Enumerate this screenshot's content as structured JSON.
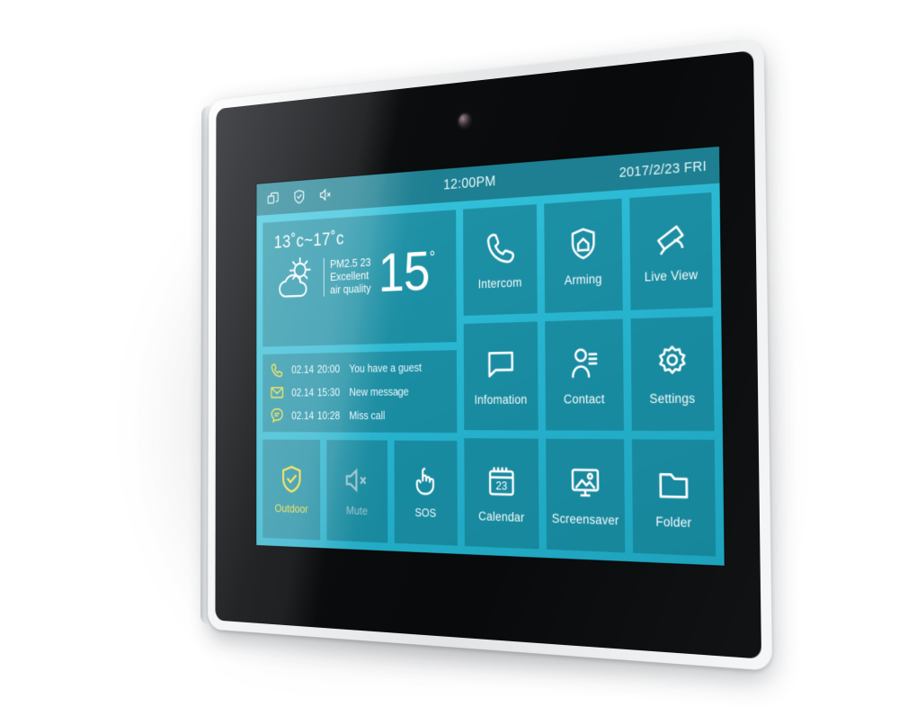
{
  "device": {
    "type": "indoor-station-touch-panel"
  },
  "statusbar": {
    "icons": [
      "windows-stack-icon",
      "shield-check-icon",
      "volume-mute-icon"
    ],
    "time": "12:00PM",
    "date": "2017/2/23 FRI"
  },
  "weather": {
    "range": "13˚c~17˚c",
    "icon": "sun-behind-cloud-icon",
    "pm_label": "PM2.5",
    "pm_value": "23",
    "quality_line1": "Excellent",
    "quality_line2": "air quality",
    "temperature": "15",
    "degree": "°"
  },
  "messages": [
    {
      "icon": "phone-icon",
      "date": "02.14",
      "time": "20:00",
      "text": "You have a guest"
    },
    {
      "icon": "envelope-icon",
      "date": "02.14",
      "time": "15:30",
      "text": "New message"
    },
    {
      "icon": "chat-bubble-icon",
      "date": "02.14",
      "time": "10:28",
      "text": "Miss call"
    }
  ],
  "quick_actions": [
    {
      "label": "Outdoor",
      "icon": "shield-check-icon",
      "state": "active"
    },
    {
      "label": "Mute",
      "icon": "volume-mute-icon",
      "state": "dim"
    },
    {
      "label": "SOS",
      "icon": "hand-press-icon",
      "state": "normal"
    }
  ],
  "apps": [
    {
      "label": "Intercom",
      "icon": "phone-handset-icon"
    },
    {
      "label": "Arming",
      "icon": "shield-home-icon"
    },
    {
      "label": "Live View",
      "icon": "cctv-camera-icon"
    },
    {
      "label": "Infomation",
      "icon": "speech-bubble-icon"
    },
    {
      "label": "Contact",
      "icon": "person-list-icon"
    },
    {
      "label": "Settings",
      "icon": "gear-icon"
    },
    {
      "label": "Calendar",
      "icon": "calendar-icon",
      "day": "23"
    },
    {
      "label": "Screensaver",
      "icon": "monitor-picture-icon"
    },
    {
      "label": "Folder",
      "icon": "folder-icon"
    }
  ],
  "colors": {
    "screen_bg": "#2ebcd6",
    "tile": "#127486",
    "statusbar": "#1d7f91",
    "accent_yellow": "#f2dd3a",
    "text": "#ffffff",
    "frame": "#f1f2f3",
    "bezel": "#0a0b0c"
  }
}
